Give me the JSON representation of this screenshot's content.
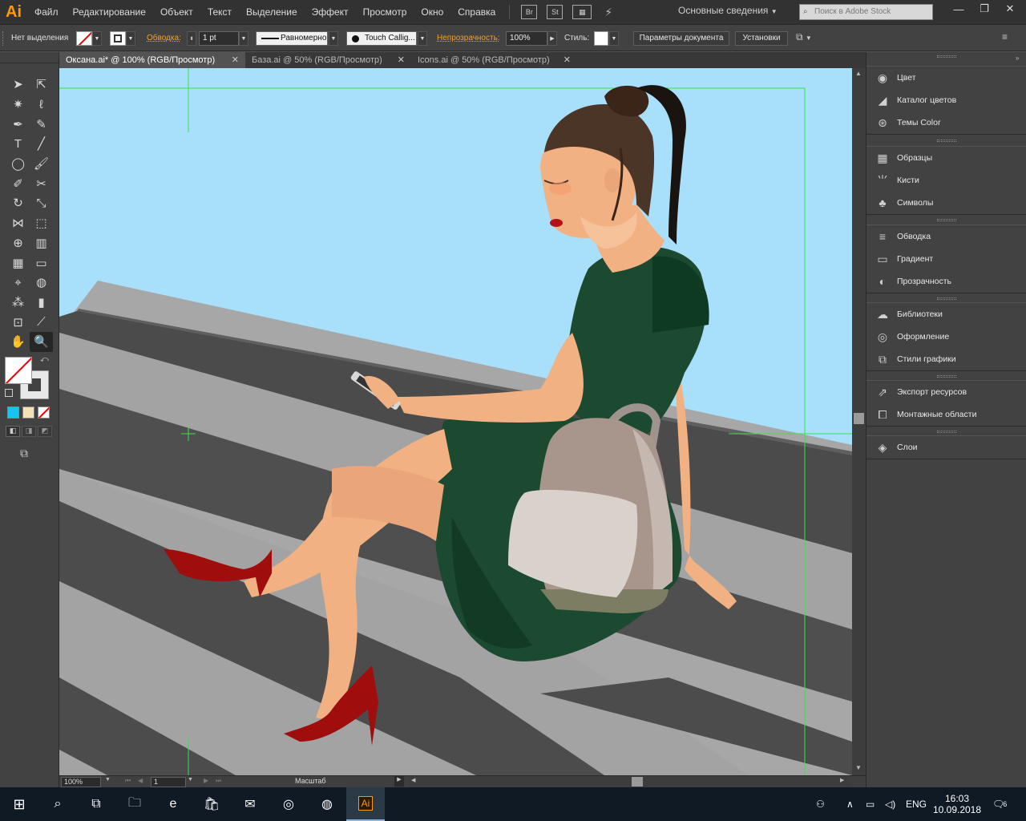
{
  "app": {
    "logo": "Ai",
    "accent_color": "#ff9a00"
  },
  "menu": {
    "items": [
      "Файл",
      "Редактирование",
      "Объект",
      "Текст",
      "Выделение",
      "Эффект",
      "Просмотр",
      "Окно",
      "Справка"
    ],
    "bridge": "Br",
    "stock": "St",
    "workspace": "Основные сведения",
    "search_placeholder": "Поиск в Adobe Stock"
  },
  "window_controls": {
    "minimize": "—",
    "restore": "❐",
    "close": "✕"
  },
  "control_bar": {
    "selection_label": "Нет выделения",
    "stroke_label": "Обводка:",
    "stroke_weight": "1 pt",
    "profile": "Равномерно",
    "brush": "Touch Callig...",
    "opacity_label": "Непрозрачность:",
    "opacity": "100%",
    "style_label": "Стиль:",
    "doc_setup_button": "Параметры документа",
    "prefs_button": "Установки"
  },
  "tabs": [
    {
      "label": "Оксана.ai* @ 100% (RGB/Просмотр)",
      "active": true
    },
    {
      "label": "База.ai @ 50% (RGB/Просмотр)",
      "active": false
    },
    {
      "label": "Icons.ai @ 50% (RGB/Просмотр)",
      "active": false
    }
  ],
  "tools": [
    {
      "name": "selection-tool",
      "glyph": "➤"
    },
    {
      "name": "direct-selection-tool",
      "glyph": "⇱"
    },
    {
      "name": "magic-wand-tool",
      "glyph": "✷"
    },
    {
      "name": "lasso-tool",
      "glyph": "ℓ"
    },
    {
      "name": "pen-tool",
      "glyph": "✒"
    },
    {
      "name": "curvature-tool",
      "glyph": "✎"
    },
    {
      "name": "type-tool",
      "glyph": "T"
    },
    {
      "name": "line-tool",
      "glyph": "╱"
    },
    {
      "name": "ellipse-tool",
      "glyph": "◯"
    },
    {
      "name": "paintbrush-tool",
      "glyph": "🖌"
    },
    {
      "name": "shaper-tool",
      "glyph": "✐"
    },
    {
      "name": "scissors-tool",
      "glyph": "✂"
    },
    {
      "name": "rotate-tool",
      "glyph": "↻"
    },
    {
      "name": "scale-tool",
      "glyph": "⤡"
    },
    {
      "name": "width-tool",
      "glyph": "⋈"
    },
    {
      "name": "free-transform-tool",
      "glyph": "⬚"
    },
    {
      "name": "shape-builder-tool",
      "glyph": "⊕"
    },
    {
      "name": "perspective-grid-tool",
      "glyph": "▥"
    },
    {
      "name": "mesh-tool",
      "glyph": "▦"
    },
    {
      "name": "gradient-tool",
      "glyph": "▭"
    },
    {
      "name": "eyedropper-tool",
      "glyph": "⌖"
    },
    {
      "name": "blend-tool",
      "glyph": "◍"
    },
    {
      "name": "symbol-sprayer-tool",
      "glyph": "⁂"
    },
    {
      "name": "column-graph-tool",
      "glyph": "▮"
    },
    {
      "name": "artboard-tool",
      "glyph": "⊡"
    },
    {
      "name": "slice-tool",
      "glyph": "⟋"
    },
    {
      "name": "hand-tool",
      "glyph": "✋"
    },
    {
      "name": "zoom-tool",
      "glyph": "🔍",
      "selected": true
    }
  ],
  "right_panels": {
    "group1": [
      {
        "label": "Цвет",
        "icon": "color-icon",
        "glyph": "◉"
      },
      {
        "label": "Каталог цветов",
        "icon": "color-guide-icon",
        "glyph": "◢"
      },
      {
        "label": "Темы Color",
        "icon": "color-themes-icon",
        "glyph": "⊛"
      }
    ],
    "group2": [
      {
        "label": "Образцы",
        "icon": "swatches-icon",
        "glyph": "▦"
      },
      {
        "label": "Кисти",
        "icon": "brushes-icon",
        "glyph": "⺌"
      },
      {
        "label": "Символы",
        "icon": "symbols-icon",
        "glyph": "♣"
      }
    ],
    "group3": [
      {
        "label": "Обводка",
        "icon": "stroke-icon",
        "glyph": "≡"
      },
      {
        "label": "Градиент",
        "icon": "gradient-icon",
        "glyph": "▭"
      },
      {
        "label": "Прозрачность",
        "icon": "transparency-icon",
        "glyph": "◐"
      }
    ],
    "group4": [
      {
        "label": "Библиотеки",
        "icon": "libraries-icon",
        "glyph": "☁"
      },
      {
        "label": "Оформление",
        "icon": "appearance-icon",
        "glyph": "◎"
      },
      {
        "label": "Стили графики",
        "icon": "graphic-styles-icon",
        "glyph": "⧉"
      }
    ],
    "group5": [
      {
        "label": "Экспорт ресурсов",
        "icon": "asset-export-icon",
        "glyph": "⇗"
      },
      {
        "label": "Монтажные области",
        "icon": "artboards-icon",
        "glyph": "⧠"
      }
    ],
    "group6": [
      {
        "label": "Слои",
        "icon": "layers-icon",
        "glyph": "◈"
      }
    ]
  },
  "status_bar": {
    "zoom": "100%",
    "artboard": "1",
    "status": "Масштаб"
  },
  "taskbar": {
    "language": "ENG",
    "time": "16:03",
    "date": "10.09.2018",
    "notifications": "6",
    "apps": [
      {
        "name": "file-explorer-icon",
        "glyph": "🗀"
      },
      {
        "name": "edge-icon",
        "glyph": "e"
      },
      {
        "name": "store-icon",
        "glyph": "🛍"
      },
      {
        "name": "mail-icon",
        "glyph": "✉"
      },
      {
        "name": "instagram-icon",
        "glyph": "◎"
      },
      {
        "name": "chrome-icon",
        "glyph": "◍"
      },
      {
        "name": "illustrator-icon",
        "glyph": "Ai"
      }
    ]
  },
  "colors": {
    "sky": "#a8dffb",
    "stair_light": "#a7a7a7",
    "stair_dark": "#4c4c4c",
    "dress": "#1b4a30",
    "skin": "#f2b182",
    "shoe": "#a00d0d",
    "hair": "#4b3527",
    "backpack": "#a8958c"
  }
}
